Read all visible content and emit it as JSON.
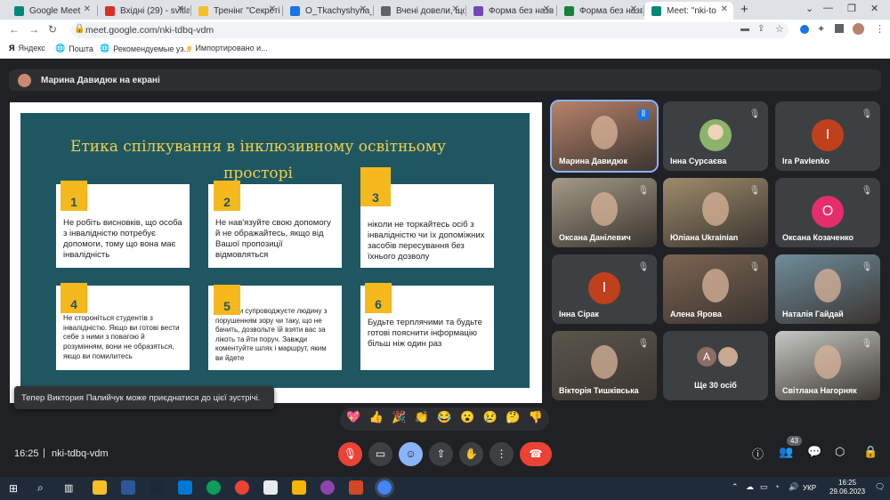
{
  "browser": {
    "tabs": [
      {
        "label": "Google Meet",
        "color": "#00897b"
      },
      {
        "label": "Вхідні (29) - svitla",
        "color": "#d93025"
      },
      {
        "label": "Тренінг \"Секреті",
        "color": "#f6bf26"
      },
      {
        "label": "O_Tkachyshyna_f",
        "color": "#1a73e8"
      },
      {
        "label": "Вчені довели, що",
        "color": "#5f6368"
      },
      {
        "label": "Форма без назв",
        "color": "#7248b9"
      },
      {
        "label": "Форма без назв",
        "color": "#188038"
      },
      {
        "label": "Meet: \"nki-to",
        "color": "#00897b"
      }
    ],
    "url": "meet.google.com/nki-tdbq-vdm",
    "bookmarks": [
      "Яндекс",
      "Пошта",
      "Рекомендуемые уз...",
      "Импортировано и..."
    ]
  },
  "meet": {
    "presenter_banner": "Марина Давидюк на екрані",
    "slide": {
      "title": "Етика спілкування в інклюзивному освітньому просторі",
      "cards": [
        {
          "num": "1",
          "text": "Не робіть висновків, що особа з інвалідністю потребує допомоги, тому що вона має інвалідність"
        },
        {
          "num": "2",
          "text": "Не нав'язуйте свою допомогу й не ображайтесь, якщо від Вашої пропозиції відмовляться"
        },
        {
          "num": "3",
          "text": "ніколи не торкайтесь осіб з інвалідністю чи їх допоміжних засобів пересування без їхнього дозволу"
        },
        {
          "num": "4",
          "text": "Не сторонiться студентів з інвалідністю. Якщо ви готові вести себе з ними з повагою й розумінням, вони не образяться, якщо ви помилитесь"
        },
        {
          "num": "5",
          "text": "Якщо ви супроводжуєте людину з порушенням зору чи таку, що не бачить, дозвольте їй взяти вас за лікоть та йти поруч. Завжди коментуйте шлях і маршрут, яким ви йдете"
        },
        {
          "num": "6",
          "text": "Будьте терплячими та будьте готові пояснити інформацію більш ніж один раз"
        }
      ]
    },
    "participants": [
      {
        "name": "Марина Давидюк",
        "type": "photo",
        "color": "#b8826a"
      },
      {
        "name": "Інна Сурсаєва",
        "type": "avatar",
        "color": "#8bb36a"
      },
      {
        "name": "Ira Pavlenko",
        "type": "letter",
        "letter": "I",
        "color": "#c1401c"
      },
      {
        "name": "Оксана Данілевич",
        "type": "photo",
        "color": "#a39a86"
      },
      {
        "name": "Юліана Ukrainian",
        "type": "photo",
        "color": "#9e8b6b"
      },
      {
        "name": "Оксана Козаченко",
        "type": "letter",
        "letter": "O",
        "color": "#e52d6b"
      },
      {
        "name": "Інна Сірак",
        "type": "letter",
        "letter": "I",
        "color": "#c1401c"
      },
      {
        "name": "Алена Ярова",
        "type": "photo",
        "color": "#7d6452"
      },
      {
        "name": "Наталія Гайдай",
        "type": "photo",
        "color": "#6f8d9c"
      },
      {
        "name": "Вікторія Тишківська",
        "type": "photo",
        "color": "#5b564c"
      },
      {
        "name": "Ще 30 осіб",
        "type": "group",
        "letter": "А",
        "color": "#8d6e63"
      },
      {
        "name": "Світлана Нагорняк",
        "type": "photo",
        "color": "#c7c9c4"
      }
    ],
    "toast": "Тепер Виктория Палийчук може приєднатися до цієї зустрічі.",
    "reactions": [
      "💖",
      "👍",
      "🎉",
      "👏",
      "😂",
      "😮",
      "😢",
      "🤔",
      "👎"
    ],
    "time": "16:25",
    "meeting_code": "nki-tdbq-vdm",
    "people_count": "43"
  },
  "taskbar": {
    "lang": "УКР",
    "time": "16:25",
    "date": "29.06.2023"
  }
}
